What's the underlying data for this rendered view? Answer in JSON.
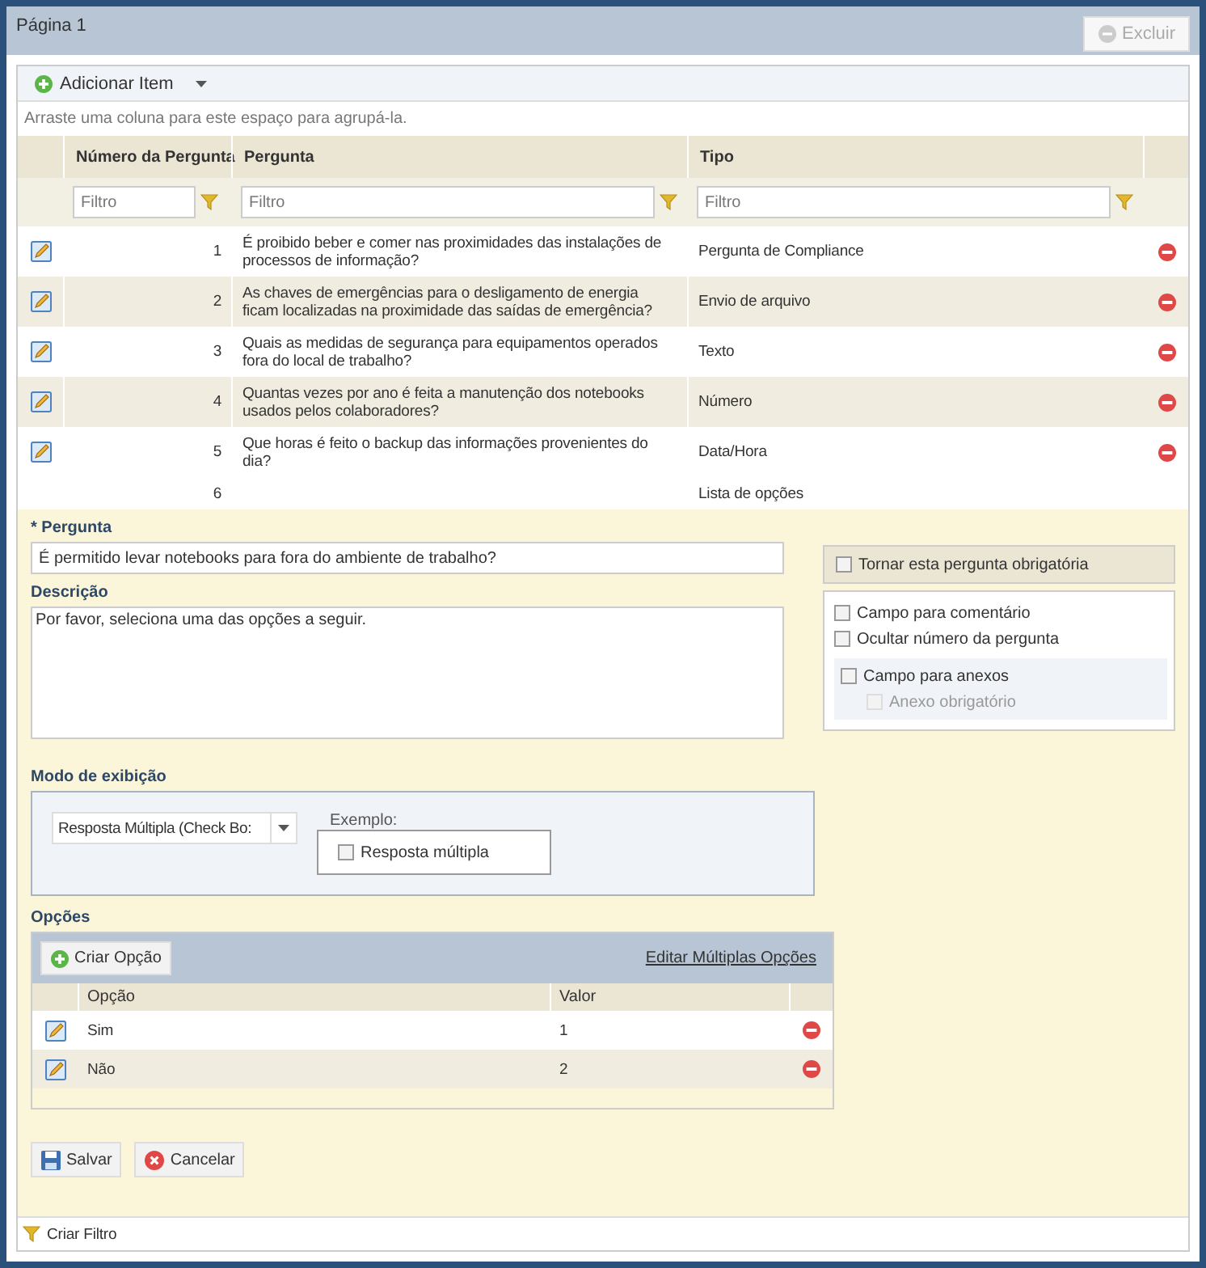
{
  "page": {
    "title": "Página 1",
    "delete_button": {
      "label": "Excluir",
      "disabled": true
    }
  },
  "grid": {
    "toolbar": {
      "add_label": "Adicionar Item"
    },
    "group_hint": "Arraste uma coluna para este espaço para agrupá-la.",
    "columns": [
      "Número da Pergunta",
      "Pergunta",
      "Tipo"
    ],
    "filters": [
      {
        "placeholder": "Filtro"
      },
      {
        "placeholder": "Filtro"
      },
      {
        "placeholder": "Filtro"
      }
    ],
    "rows": [
      {
        "number": "1",
        "question": "É proibido beber e comer nas proximidades das instalações de processos de informação?",
        "type": "Pergunta de Compliance"
      },
      {
        "number": "2",
        "question": "As chaves de emergências para o desligamento de energia ficam localizadas na proximidade das saídas de emergência?",
        "type": "Envio de arquivo"
      },
      {
        "number": "3",
        "question": "Quais as medidas de segurança para equipamentos operados fora do local de trabalho?",
        "type": "Texto"
      },
      {
        "number": "4",
        "question": "Quantas vezes por ano é feita a manutenção dos notebooks usados pelos colaboradores?",
        "type": "Número"
      },
      {
        "number": "5",
        "question": "Que horas é feito o backup das informações provenientes do dia?",
        "type": "Data/Hora"
      }
    ],
    "edit_row": {
      "number": "6",
      "type": "Lista de opções"
    },
    "footer": "Criar Filtro"
  },
  "form": {
    "question_label": "* Pergunta",
    "question_value": "É permitido levar notebooks para fora do ambiente de trabalho?",
    "description_label": "Descrição",
    "description_value": "Por favor, seleciona uma das opções a seguir.",
    "required": {
      "label": "Tornar esta pergunta obrigatória",
      "checked": false
    },
    "settings": [
      {
        "label": "Campo para comentário",
        "checked": false
      },
      {
        "label": "Ocultar número da pergunta",
        "checked": false
      }
    ],
    "attachments": {
      "label": "Campo para anexos",
      "checked": false,
      "sub": {
        "label": "Anexo obrigatório",
        "checked": false,
        "disabled": true
      }
    },
    "display_label": "Modo de exibição",
    "display_value": "Resposta Múltipla (Check Bo:",
    "example_label": "Exemplo:",
    "example_item": {
      "label": "Resposta múltipla",
      "checked": false
    },
    "options_label": "Opções",
    "create_option": "Criar Opção",
    "edit_multiple": "Editar Múltiplas Opções",
    "option_columns": [
      "Opção",
      "Valor"
    ],
    "options": [
      {
        "option": "Sim",
        "value": "1"
      },
      {
        "option": "Não",
        "value": "2"
      }
    ],
    "save": "Salvar",
    "cancel": "Cancelar"
  }
}
